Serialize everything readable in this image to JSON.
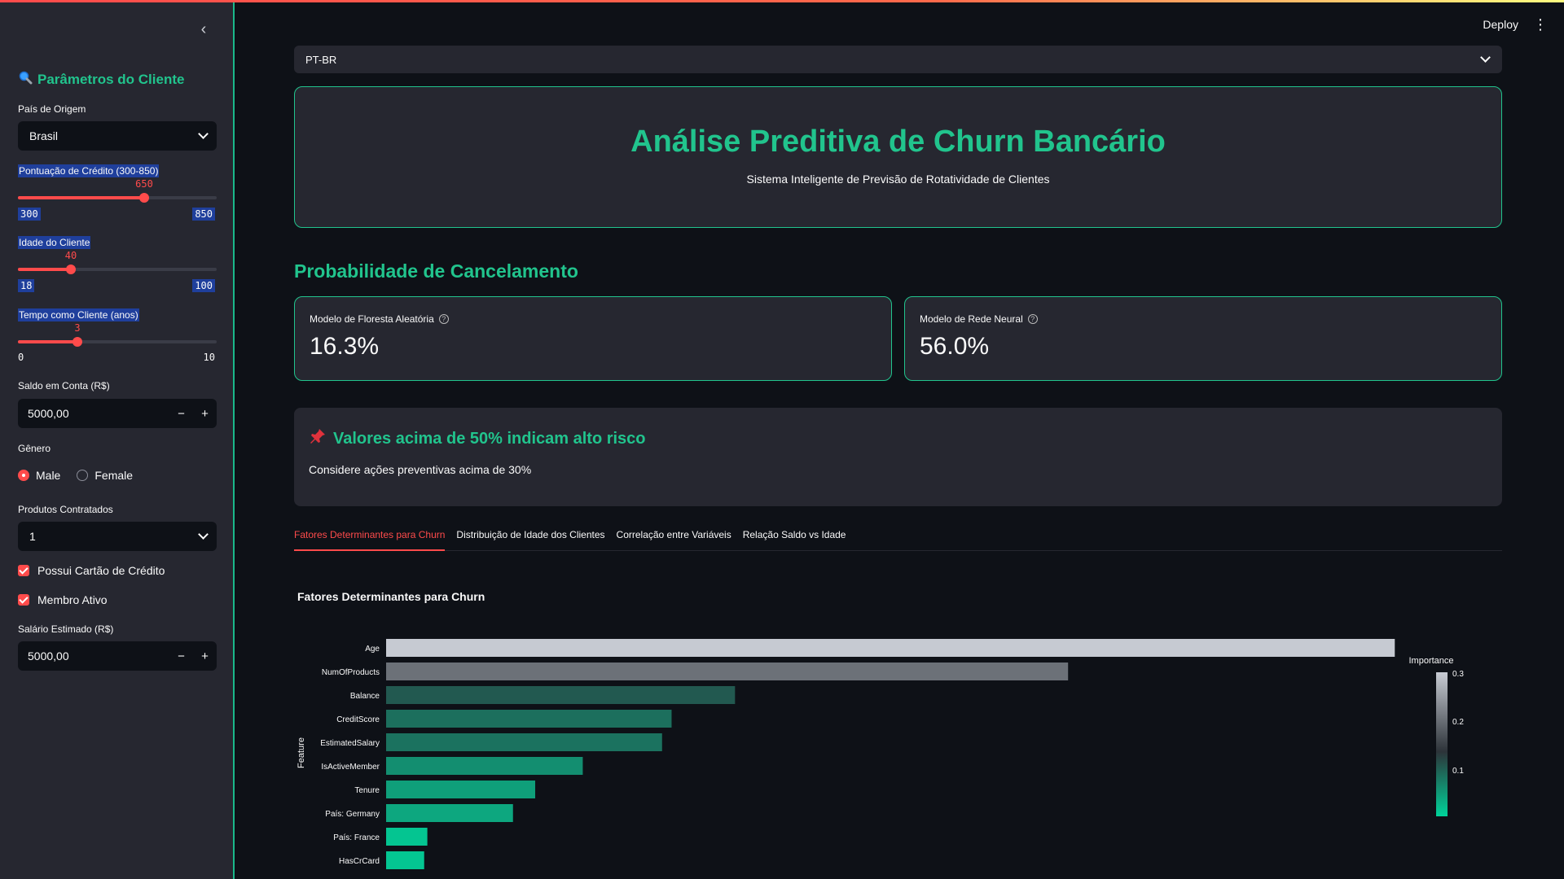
{
  "sidebar": {
    "collapse_icon": "chevron-left-icon",
    "title": "Parâmetros do Cliente",
    "title_icon": "magnifier-icon",
    "country_label": "País de Origem",
    "country_value": "Brasil",
    "credit_label": "Pontuação de Crédito (300-850)",
    "credit_value": "650",
    "credit_min": "300",
    "credit_max": "850",
    "credit_fraction": 0.636,
    "age_label": "Idade do Cliente",
    "age_value": "40",
    "age_min": "18",
    "age_max": "100",
    "age_fraction": 0.268,
    "tenure_label": "Tempo como Cliente (anos)",
    "tenure_value": "3",
    "tenure_min": "0",
    "tenure_max": "10",
    "tenure_fraction": 0.3,
    "balance_label": "Saldo em Conta (R$)",
    "balance_value": "5000,00",
    "gender_label": "Gênero",
    "gender_options": [
      "Male",
      "Female"
    ],
    "gender_selected": "Male",
    "products_label": "Produtos Contratados",
    "products_value": "1",
    "has_card_label": "Possui Cartão de Crédito",
    "active_label": "Membro Ativo",
    "salary_label": "Salário Estimado (R$)",
    "salary_value": "5000,00",
    "minus": "−",
    "plus": "+"
  },
  "header": {
    "deploy_label": "Deploy",
    "menu_icon": "kebab-menu-icon"
  },
  "main": {
    "language_value": "PT-BR",
    "hero_title": "Análise Preditiva de Churn Bancário",
    "hero_subtitle": "Sistema Inteligente de Previsão de Rotatividade de Clientes",
    "section_title": "Probabilidade de Cancelamento",
    "metric_rf_label": "Modelo de Floresta Aleatória",
    "metric_rf_value": "16.3%",
    "metric_nn_label": "Modelo de Rede Neural",
    "metric_nn_value": "56.0%",
    "info_title": "Valores acima de 50% indicam alto risco",
    "info_icon": "pushpin-icon",
    "info_text": "Considere ações preventivas acima de 30%",
    "tabs": [
      "Fatores Determinantes para Churn",
      "Distribuição de Idade dos Clientes",
      "Correlação entre Variáveis",
      "Relação Saldo vs Idade"
    ],
    "active_tab": 0
  },
  "chart_data": {
    "type": "bar",
    "orientation": "horizontal",
    "title": "Fatores Determinantes para Churn",
    "ylabel": "Feature",
    "colorbar_title": "Importance",
    "colorbar_ticks": [
      "0.1",
      "0.2",
      "0.3"
    ],
    "categories": [
      "Age",
      "NumOfProducts",
      "Balance",
      "CreditScore",
      "EstimatedSalary",
      "IsActiveMember",
      "Tenure",
      "País: Germany",
      "País: France",
      "HasCrCard"
    ],
    "values": [
      0.318,
      0.215,
      0.11,
      0.09,
      0.087,
      0.062,
      0.047,
      0.04,
      0.013,
      0.012
    ],
    "xlim": [
      0,
      0.33
    ],
    "colors": {
      "high": "#c8ccd4",
      "mid": "#2d3339",
      "low": "#00d39a"
    }
  }
}
